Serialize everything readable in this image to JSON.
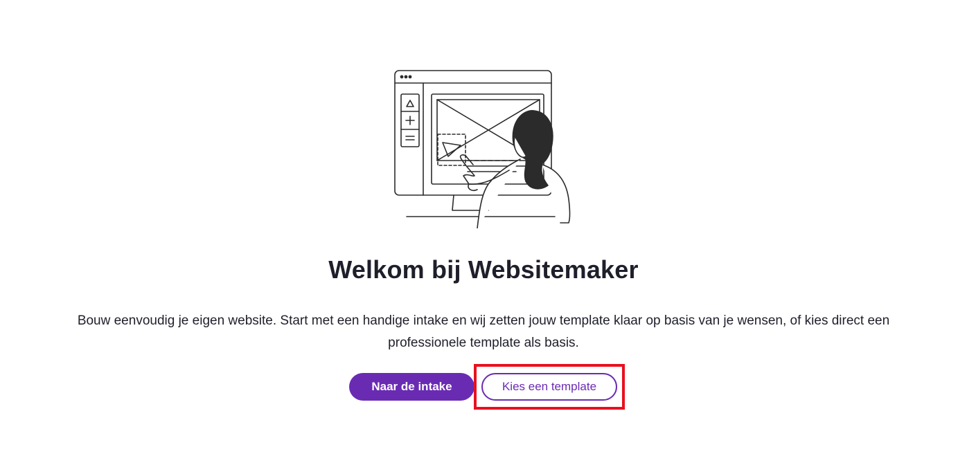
{
  "hero": {
    "illustration_icon": "person-designing-website-illustration",
    "title": "Welkom bij Websitemaker",
    "description": "Bouw eenvoudig je eigen website. Start met een handige intake en wij zetten jouw template klaar op basis van je wensen, of kies direct een professionele template als basis."
  },
  "actions": {
    "primary_label": "Naar de intake",
    "secondary_label": "Kies een template"
  },
  "colors": {
    "accent": "#6a2bb3",
    "highlight": "#e8101f",
    "text": "#1f1f2b"
  }
}
